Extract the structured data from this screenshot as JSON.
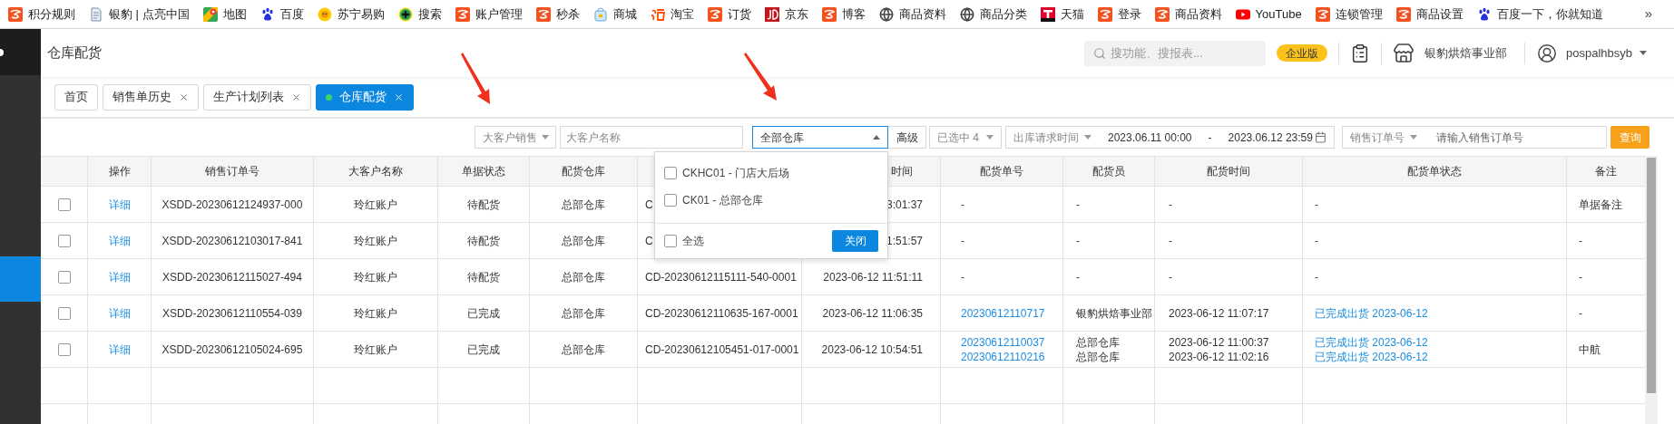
{
  "bookmarks": {
    "items": [
      {
        "kind": "pospal",
        "label": "积分规则"
      },
      {
        "kind": "document",
        "label": "银豹 | 点亮中国"
      },
      {
        "kind": "map",
        "label": "地图"
      },
      {
        "kind": "paw",
        "label": "百度"
      },
      {
        "kind": "sun",
        "label": "苏宁易购"
      },
      {
        "kind": "plus",
        "label": "搜索"
      },
      {
        "kind": "pospal",
        "label": "账户管理"
      },
      {
        "kind": "pospal",
        "label": "秒杀"
      },
      {
        "kind": "bag",
        "label": "商城"
      },
      {
        "kind": "taobao",
        "label": "淘宝"
      },
      {
        "kind": "pospal",
        "label": "订货"
      },
      {
        "kind": "jd",
        "label": "京东"
      },
      {
        "kind": "pospal",
        "label": "博客"
      },
      {
        "kind": "globe",
        "label": "商品资料"
      },
      {
        "kind": "globe",
        "label": "商品分类"
      },
      {
        "kind": "tmall",
        "label": "天猫"
      },
      {
        "kind": "pospal",
        "label": "登录"
      },
      {
        "kind": "pospal",
        "label": "商品资料"
      },
      {
        "kind": "play",
        "label": "YouTube"
      },
      {
        "kind": "pospal",
        "label": "连锁管理"
      },
      {
        "kind": "pospal",
        "label": "商品设置"
      },
      {
        "kind": "paw",
        "label": "百度一下，你就知道"
      }
    ],
    "more": "»"
  },
  "sidebar": {
    "items": [
      {
        "selected": false
      },
      {
        "selected": false
      },
      {
        "selected": false
      },
      {
        "selected": false
      },
      {
        "selected": true
      }
    ]
  },
  "header": {
    "title": "仓库配货",
    "search": {
      "placeholder": "搜功能、搜报表..."
    },
    "edition_badge": "企业版",
    "store_name": "银豹烘焙事业部",
    "username": "pospalhbsyb"
  },
  "tabs": [
    {
      "label": "首页",
      "closable": false,
      "selected": false
    },
    {
      "label": "销售单历史",
      "closable": true,
      "selected": false
    },
    {
      "label": "生产计划列表",
      "closable": true,
      "selected": false
    },
    {
      "label": "仓库配货",
      "closable": true,
      "selected": true
    }
  ],
  "filters": {
    "customer_type_select": "大客户销售",
    "customer_name": {
      "placeholder": "大客户名称"
    },
    "warehouse_select": {
      "value": "全部仓库",
      "expanded": true
    },
    "advanced_button": "高级",
    "selected_count_select": "已选中 4",
    "date_range": {
      "type_select": "出库请求时间",
      "start": "2023.06.11 00:00",
      "separator": "-",
      "end": "2023.06.12 23:59"
    },
    "order_search": {
      "field_select": "销售订单号",
      "placeholder": "请输入销售订单号"
    },
    "query_button": "查询"
  },
  "warehouse_dropdown": {
    "options": [
      {
        "label": "CKHC01 - 门店大后场",
        "checked": false
      },
      {
        "label": "CK01 - 总部仓库",
        "checked": false
      }
    ],
    "select_all": {
      "label": "全选",
      "checked": false
    },
    "close_button": "关闭"
  },
  "table": {
    "columns": [
      {
        "kind": "checkbox"
      },
      {
        "label": "操作",
        "kind": "link"
      },
      {
        "label": "销售订单号",
        "kind": "text"
      },
      {
        "label": "大客户名称",
        "kind": "text"
      },
      {
        "label": "单据状态",
        "kind": "text"
      },
      {
        "label": "配货仓库",
        "kind": "text"
      },
      {
        "kind": "text"
      },
      {
        "label": "时间",
        "kind": "text"
      },
      {
        "label": "配货单号",
        "kind": "link"
      },
      {
        "label": "配货员",
        "kind": "text"
      },
      {
        "label": "配货时间",
        "kind": "text"
      },
      {
        "label": "配货单状态",
        "kind": "link"
      },
      {
        "label": "备注",
        "kind": "text"
      }
    ],
    "rows": [
      {
        "cells": [
          {
            "checked": false
          },
          "详细",
          "XSDD-20230612124937-000",
          "玲红账户",
          "待配货",
          "总部仓库",
          "C",
          "3:01:37",
          "-",
          "-",
          "-",
          "-",
          "单据备注"
        ]
      },
      {
        "cells": [
          {
            "checked": false
          },
          "详细",
          "XSDD-20230612103017-841",
          "玲红账户",
          "待配货",
          "总部仓库",
          "C",
          "1:51:57",
          "-",
          "-",
          "-",
          "-",
          "-"
        ]
      },
      {
        "cells": [
          {
            "checked": false
          },
          "详细",
          "XSDD-20230612115027-494",
          "玲红账户",
          "待配货",
          "总部仓库",
          "CD-20230612115111-540-0001",
          "2023-06-12 11:51:11",
          "-",
          "-",
          "-",
          "-",
          "-"
        ]
      },
      {
        "cells": [
          {
            "checked": false
          },
          "详细",
          "XSDD-20230612110554-039",
          "玲红账户",
          "已完成",
          "总部仓库",
          "CD-20230612110635-167-0001",
          "2023-06-12 11:06:35",
          [
            "20230612110717"
          ],
          [
            "银豹烘焙事业部"
          ],
          [
            "2023-06-12 11:07:17"
          ],
          [
            "已完成出货 2023-06-12"
          ],
          "-"
        ]
      },
      {
        "cells": [
          {
            "checked": false
          },
          "详细",
          "XSDD-20230612105024-695",
          "玲红账户",
          "已完成",
          "总部仓库",
          "CD-20230612105451-017-0001",
          "2023-06-12 10:54:51",
          [
            "20230612110037",
            "20230612110216"
          ],
          [
            "总部仓库",
            "总部仓库"
          ],
          [
            "2023-06-12 11:00:37",
            "2023-06-12 11:02:16"
          ],
          [
            "已完成出货 2023-06-12",
            "已完成出货 2023-06-12"
          ],
          "中航"
        ]
      }
    ]
  }
}
